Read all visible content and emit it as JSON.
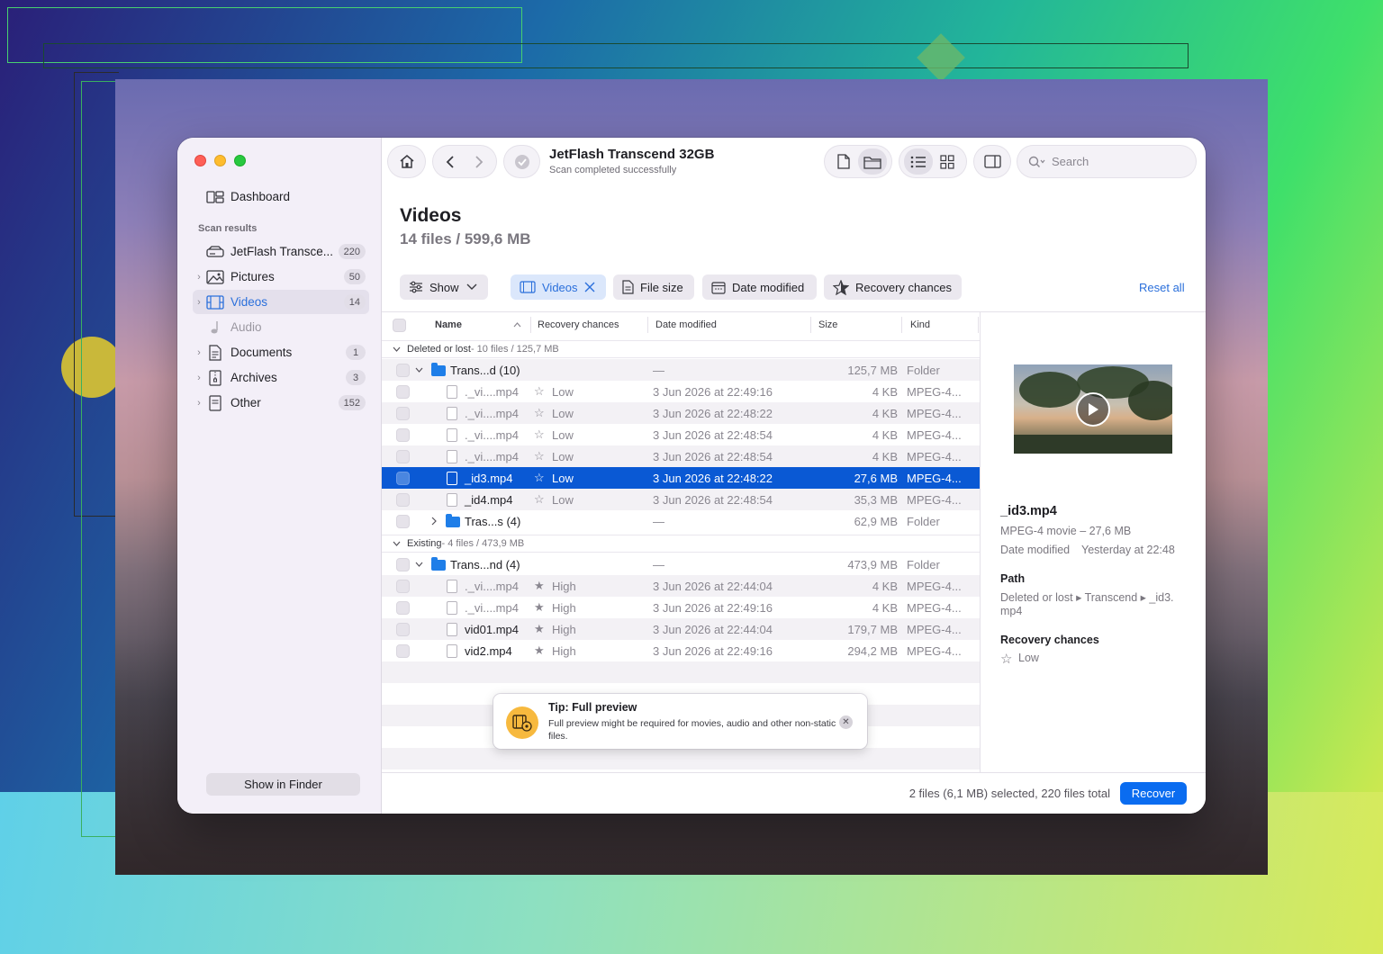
{
  "toolbar": {
    "device_title": "JetFlash Transcend 32GB",
    "device_status": "Scan completed successfully",
    "search_placeholder": "Search"
  },
  "sidebar": {
    "dashboard_label": "Dashboard",
    "section_label": "Scan results",
    "items": [
      {
        "label": "JetFlash Transce...",
        "count": "220",
        "icon": "drive-icon"
      },
      {
        "label": "Pictures",
        "count": "50",
        "icon": "image-icon"
      },
      {
        "label": "Videos",
        "count": "14",
        "icon": "film-icon"
      },
      {
        "label": "Audio",
        "count": "",
        "icon": "music-icon"
      },
      {
        "label": "Documents",
        "count": "1",
        "icon": "document-icon"
      },
      {
        "label": "Archives",
        "count": "3",
        "icon": "archive-icon"
      },
      {
        "label": "Other",
        "count": "152",
        "icon": "other-file-icon"
      }
    ],
    "show_in_finder": "Show in Finder"
  },
  "header": {
    "title": "Videos",
    "subtitle": "14 files / 599,6 MB"
  },
  "filters": {
    "show": "Show",
    "videos": "Videos",
    "file_size": "File size",
    "date_modified": "Date modified",
    "recovery_chances": "Recovery chances",
    "reset_all": "Reset all"
  },
  "table": {
    "columns": {
      "name": "Name",
      "recovery": "Recovery chances",
      "date": "Date modified",
      "size": "Size",
      "kind": "Kind"
    },
    "group1": {
      "label": "Deleted or lost",
      "meta": " - 10 files / 125,7 MB"
    },
    "group2": {
      "label": "Existing",
      "meta": " - 4 files / 473,9 MB"
    },
    "rows": [
      {
        "name": "Trans...d (10)",
        "recovery": "",
        "date": "—",
        "size": "125,7 MB",
        "kind": "Folder"
      },
      {
        "name": "._vi....mp4",
        "recovery": "Low",
        "date": "3 Jun 2026 at 22:49:16",
        "size": "4 KB",
        "kind": "MPEG-4..."
      },
      {
        "name": "._vi....mp4",
        "recovery": "Low",
        "date": "3 Jun 2026 at 22:48:22",
        "size": "4 KB",
        "kind": "MPEG-4..."
      },
      {
        "name": "._vi....mp4",
        "recovery": "Low",
        "date": "3 Jun 2026 at 22:48:54",
        "size": "4 KB",
        "kind": "MPEG-4..."
      },
      {
        "name": "._vi....mp4",
        "recovery": "Low",
        "date": "3 Jun 2026 at 22:48:54",
        "size": "4 KB",
        "kind": "MPEG-4..."
      },
      {
        "name": "_id3.mp4",
        "recovery": "Low",
        "date": "3 Jun 2026 at 22:48:22",
        "size": "27,6 MB",
        "kind": "MPEG-4..."
      },
      {
        "name": "_id4.mp4",
        "recovery": "Low",
        "date": "3 Jun 2026 at 22:48:54",
        "size": "35,3 MB",
        "kind": "MPEG-4..."
      },
      {
        "name": "Tras...s (4)",
        "recovery": "",
        "date": "—",
        "size": "62,9 MB",
        "kind": "Folder"
      },
      {
        "name": "Trans...nd (4)",
        "recovery": "",
        "date": "—",
        "size": "473,9 MB",
        "kind": "Folder"
      },
      {
        "name": "._vi....mp4",
        "recovery": "High",
        "date": "3 Jun 2026 at 22:44:04",
        "size": "4 KB",
        "kind": "MPEG-4..."
      },
      {
        "name": "._vi....mp4",
        "recovery": "High",
        "date": "3 Jun 2026 at 22:49:16",
        "size": "4 KB",
        "kind": "MPEG-4..."
      },
      {
        "name": "vid01.mp4",
        "recovery": "High",
        "date": "3 Jun 2026 at 22:44:04",
        "size": "179,7 MB",
        "kind": "MPEG-4..."
      },
      {
        "name": "vid2.mp4",
        "recovery": "High",
        "date": "3 Jun 2026 at 22:49:16",
        "size": "294,2 MB",
        "kind": "MPEG-4..."
      }
    ]
  },
  "tip": {
    "title": "Tip: Full preview",
    "body": "Full preview might be required for movies, audio and other non-static files."
  },
  "preview": {
    "name": "_id3.mp4",
    "type_size": "MPEG-4 movie – 27,6 MB",
    "date_label": "Date modified",
    "date_value": "Yesterday at 22:48",
    "path_label": "Path",
    "path_value": "Deleted or lost ▸ Transcend ▸ _id3.",
    "path_value2": "mp4",
    "recovery_label": "Recovery chances",
    "recovery_value": "Low"
  },
  "footer": {
    "status": "2 files (6,1 MB) selected, 220 files total",
    "recover": "Recover"
  },
  "colors": {
    "accent": "#0a6cf0",
    "selection": "#0a59d4",
    "folder": "#1f7ee8"
  }
}
